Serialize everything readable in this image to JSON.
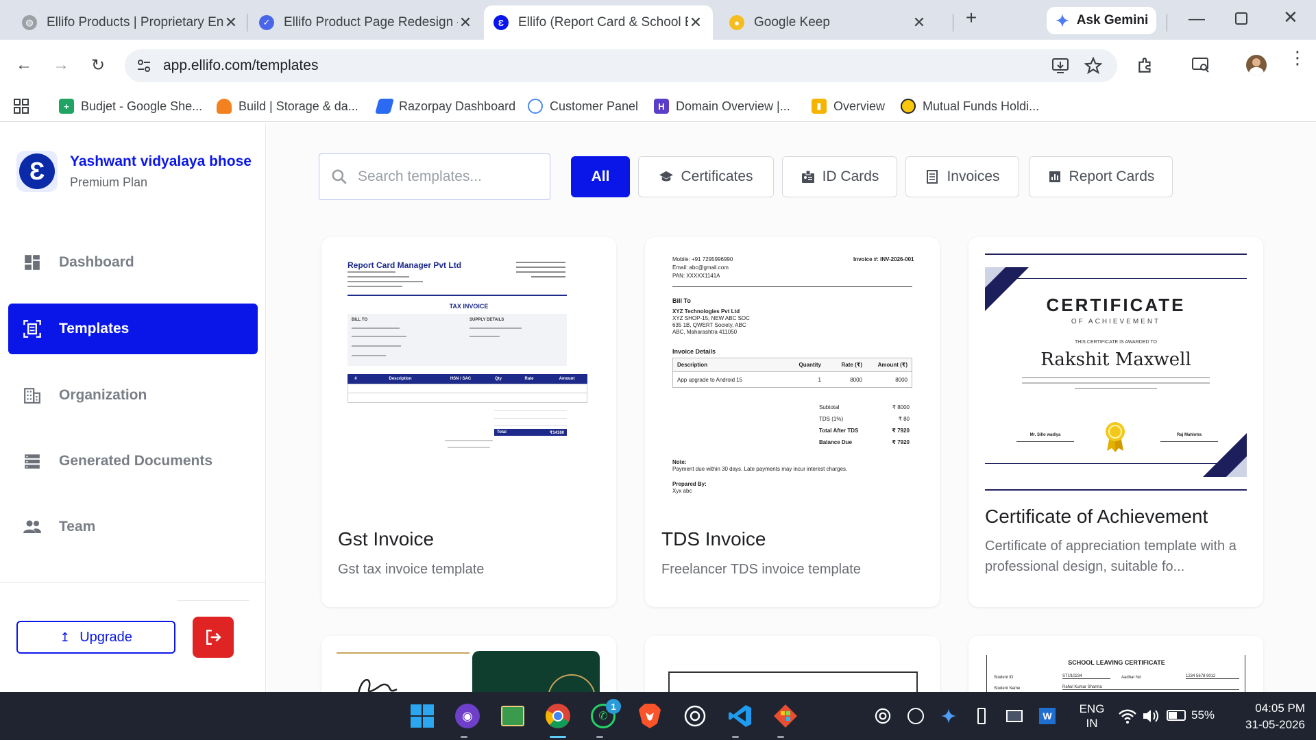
{
  "browser": {
    "tabs": [
      {
        "title": "Ellifo Products | Proprietary En",
        "active": false
      },
      {
        "title": "Ellifo Product Page Redesign -",
        "active": false
      },
      {
        "title": "Ellifo (Report Card & School E",
        "active": true
      },
      {
        "title": "Google Keep",
        "active": false
      }
    ],
    "ask_gemini": "Ask Gemini",
    "url": "app.ellifo.com/templates",
    "bookmarks": [
      "Budjet - Google She...",
      "Build | Storage & da...",
      "Razorpay Dashboard",
      "Customer Panel",
      "Domain Overview |...",
      "Overview",
      "Mutual Funds Holdi..."
    ]
  },
  "org": {
    "logo_letter": "Ɛ",
    "name": "Yashwant vidyalaya bhose",
    "plan": "Premium Plan"
  },
  "sidebar": {
    "items": [
      {
        "label": "Dashboard",
        "icon": "dashboard-icon"
      },
      {
        "label": "Templates",
        "icon": "templates-icon",
        "active": true
      },
      {
        "label": "Organization",
        "icon": "building-icon"
      },
      {
        "label": "Generated Documents",
        "icon": "list-icon"
      },
      {
        "label": "Team",
        "icon": "team-icon"
      }
    ],
    "upgrade_label": "Upgrade"
  },
  "search": {
    "placeholder": "Search templates..."
  },
  "filters": [
    {
      "label": "All",
      "active": true
    },
    {
      "label": "Certificates",
      "icon": "graduation-cap-icon"
    },
    {
      "label": "ID Cards",
      "icon": "id-card-icon"
    },
    {
      "label": "Invoices",
      "icon": "receipt-icon"
    },
    {
      "label": "Report Cards",
      "icon": "chart-icon"
    }
  ],
  "cards": [
    {
      "title": "Gst Invoice",
      "description": "Gst tax invoice template"
    },
    {
      "title": "TDS Invoice",
      "description": "Freelancer TDS invoice template"
    },
    {
      "title": "Certificate of Achievement",
      "description": "Certificate of appreciation template with a professional design, suitable fo..."
    }
  ],
  "thumbnails": {
    "gst": {
      "company": "Report Card Manager Pvt Ltd",
      "heading": "TAX INVOICE",
      "bill_to": "BILL TO",
      "supply": "SUPPLY DETAILS",
      "cols": [
        "#",
        "Description",
        "HSN / SAC",
        "Qty",
        "Rate",
        "Amount"
      ],
      "total_label": "Total",
      "total_value": "₹14160"
    },
    "tds": {
      "mobile": "Mobile: +91 7295996990",
      "email": "Email: abc@gmail.com",
      "pan": "PAN: XXXXX1141A",
      "invoice_no": "Invoice #: INV-2026-001",
      "bill_to": "Bill To",
      "client": "XYZ Technologies Pvt Ltd",
      "addr1": "XYZ SHOP-15, NEW ABC SOC",
      "addr2": "635 1B, QWERT Society, ABC",
      "addr3": "ABC, Maharashtra 411050",
      "details": "Invoice Details",
      "cols": [
        "Description",
        "Quantity",
        "Rate (₹)",
        "Amount (₹)"
      ],
      "row": [
        "App upgrade to Android 15",
        "1",
        "8000",
        "8000"
      ],
      "sum_labels": [
        "Subtotal",
        "TDS (1%)",
        "Total After TDS",
        "Balance Due"
      ],
      "sum_values": [
        "₹ 8000",
        "₹ 80",
        "₹ 7920",
        "₹ 7920"
      ],
      "note_label": "Note:",
      "note": "Payment due within 30 days. Late payments may incur interest charges.",
      "prepared_label": "Prepared By:",
      "prepared": "Xyx abc"
    },
    "cert": {
      "title": "CERTIFICATE",
      "sub": "OF ACHIEVEMENT",
      "awarded": "THIS CERTIFICATE IS AWARDED TO",
      "name": "Rakshit Maxwell",
      "sign1": "Mr. Sillo wadiya",
      "sign2": "Raj Mahlotra"
    },
    "leaving": {
      "title": "SCHOOL LEAVING CERTIFICATE",
      "student_id_label": "Student ID",
      "student_id": "STU10234",
      "aadhar_label": "Aadhar No",
      "aadhar": "1234 5678 9012",
      "student_name_label": "Student Name",
      "student_name": "Rahul Kumar Sharma"
    }
  },
  "taskbar": {
    "lang": "ENG",
    "region": "IN",
    "battery": "55%",
    "time": "04:05 PM",
    "date": "31-05-2026",
    "whatsapp_badge": "1"
  },
  "colors": {
    "accent": "#0a16e8",
    "logout": "#e02424",
    "navy": "#1d1f5c"
  }
}
